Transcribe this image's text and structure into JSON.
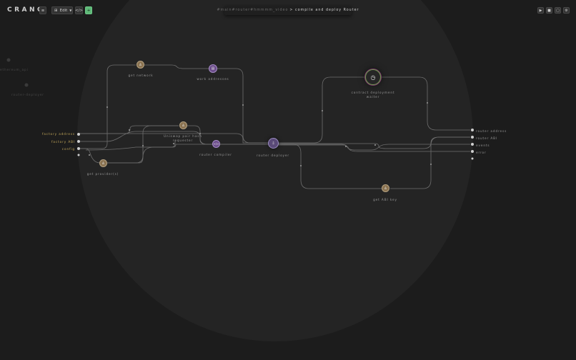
{
  "app": {
    "logo": "CRANQ"
  },
  "toolbar": {
    "menu_icon": "hamburger-icon",
    "edit_label": "Edit",
    "edit_icon": "grid-icon",
    "code_label": "</>",
    "add_label": "+"
  },
  "breadcrumb": {
    "path": "#main#router#hmmmm_video",
    "current": "> compile and deploy Router"
  },
  "right_toolbar": {
    "items": [
      "play-icon",
      "square-icon",
      "layout-icon",
      "settings-icon"
    ]
  },
  "nodes": {
    "get_network": {
      "label": "get network",
      "icon": "person-icon"
    },
    "work_addresses": {
      "label": "work addresses",
      "icon": "list-icon"
    },
    "contract_deployment_waiter": {
      "label_line1": "contract deployment",
      "label_line2": "waiter",
      "icon": "clock-icon"
    },
    "uniswap_pair_hash_requester": {
      "label_line1": "Uniswap pair hash",
      "label_line2": "requester",
      "icon": "person-icon"
    },
    "router_compiler": {
      "label": "router compiler",
      "icon": "code-icon"
    },
    "router_deployer": {
      "label": "router deployer",
      "icon": "download-icon"
    },
    "get_provider": {
      "label": "get provider(s)",
      "icon": "person-icon"
    },
    "get_abi_key": {
      "label": "get ABI key",
      "icon": "person-icon"
    }
  },
  "inputs": [
    "factory address",
    "factory ABI",
    "config"
  ],
  "outputs": [
    "router address",
    "router ABI",
    "events",
    "error"
  ],
  "ghost": {
    "left_top": "ethereum_api",
    "left_bottom": "router-deployer"
  },
  "colors": {
    "accent_green": "#5fb878",
    "input_label": "#c9ad5c",
    "node_bronze": "#8a7250",
    "node_purple": "#6b4c8a"
  }
}
